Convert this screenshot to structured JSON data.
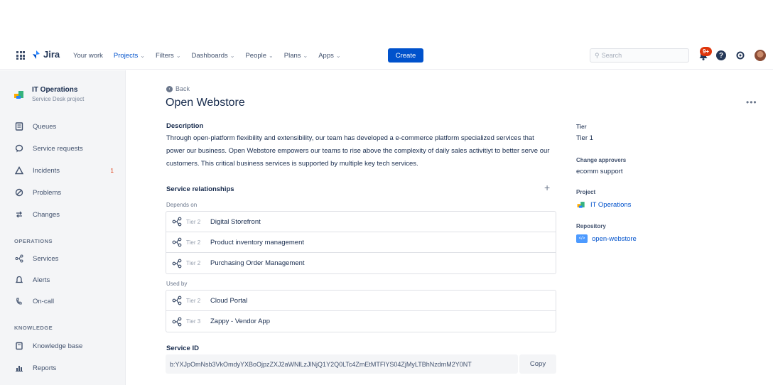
{
  "topbar": {
    "logo": "Jira",
    "nav": [
      {
        "label": "Your work",
        "dropdown": false,
        "active": false
      },
      {
        "label": "Projects",
        "dropdown": true,
        "active": true
      },
      {
        "label": "Filters",
        "dropdown": true,
        "active": false
      },
      {
        "label": "Dashboards",
        "dropdown": true,
        "active": false
      },
      {
        "label": "People",
        "dropdown": true,
        "active": false
      },
      {
        "label": "Plans",
        "dropdown": true,
        "active": false
      },
      {
        "label": "Apps",
        "dropdown": true,
        "active": false
      }
    ],
    "create_label": "Create",
    "search_placeholder": "Search",
    "notification_count": "9+"
  },
  "sidebar": {
    "project_name": "IT Operations",
    "project_type": "Service Desk project",
    "items": [
      {
        "label": "Queues",
        "icon": "queues-icon"
      },
      {
        "label": "Service requests",
        "icon": "speech-bubble-icon"
      },
      {
        "label": "Incidents",
        "icon": "warning-icon",
        "badge": "1"
      },
      {
        "label": "Problems",
        "icon": "blocked-icon"
      },
      {
        "label": "Changes",
        "icon": "changes-icon"
      }
    ],
    "operations_heading": "OPERATIONS",
    "operations_items": [
      {
        "label": "Services",
        "icon": "services-icon"
      },
      {
        "label": "Alerts",
        "icon": "bell-icon"
      },
      {
        "label": "On-call",
        "icon": "on-call-icon"
      }
    ],
    "knowledge_heading": "KNOWLEDGE",
    "knowledge_items": [
      {
        "label": "Knowledge base",
        "icon": "book-icon"
      },
      {
        "label": "Reports",
        "icon": "chart-icon"
      }
    ]
  },
  "main": {
    "back_label": "Back",
    "title": "Open Webstore",
    "description_heading": "Description",
    "description": "Through open-platform flexibility and extensibility, our team has developed a e-commerce platform specialized services that power our business. Open Webstore empowers our teams to rise above the complexity of daily sales activitiyt to better serve our customers. This critical business services is supported by multiple key tech services.",
    "relationships_heading": "Service relationships",
    "depends_on_label": "Depends on",
    "depends_on": [
      {
        "tier": "Tier 2",
        "name": "Digital Storefront"
      },
      {
        "tier": "Tier 2",
        "name": "Product inventory management"
      },
      {
        "tier": "Tier 2",
        "name": "Purchasing Order Management"
      }
    ],
    "used_by_label": "Used by",
    "used_by": [
      {
        "tier": "Tier 2",
        "name": "Cloud Portal"
      },
      {
        "tier": "Tier 3",
        "name": "Zappy - Vendor App"
      }
    ],
    "service_id_heading": "Service ID",
    "service_id": "b:YXJpOmNsb3VkOmdyYXBoOjpzZXJ2aWNlLzJlNjQ1Y2Q0LTc4ZmEtMTFlYS04ZjMyLTBhNzdmM2Y0NT",
    "copy_label": "Copy"
  },
  "details": {
    "tier_label": "Tier",
    "tier_value": "Tier 1",
    "approvers_label": "Change approvers",
    "approvers_value": "ecomm support",
    "project_label": "Project",
    "project_value": "IT Operations",
    "repository_label": "Repository",
    "repository_value": "open-webstore"
  },
  "colors": {
    "accent": "#0052cc",
    "sidebar_bg": "#f4f5f7",
    "badge": "#de350b"
  }
}
